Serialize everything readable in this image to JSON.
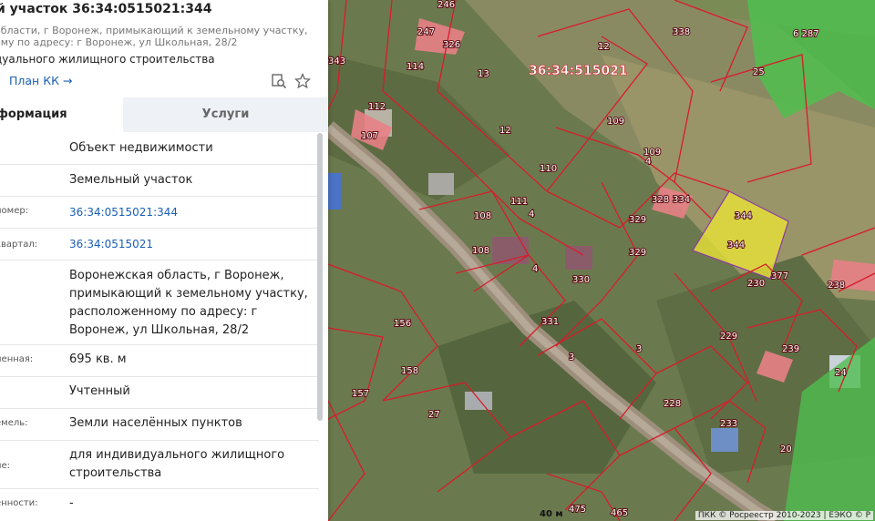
{
  "panel": {
    "title": "й участок 36:34:0515021:344",
    "subaddr": "области, г Воронеж, примыкающий к земельному участку,\nому по адресу: г Воронеж, ул Школьная, 28/2",
    "purpose": "дуального жилищного строительства",
    "plan_link": "План КК →",
    "icons": {
      "search_map": "search-map-icon",
      "favorite": "star-icon"
    },
    "tabs": {
      "info": "формация",
      "services": "Услуги"
    },
    "rows": [
      {
        "label": "",
        "value": "Объект недвижимости"
      },
      {
        "label": "",
        "value": "Земельный участок"
      },
      {
        "label": "номер:",
        "value": "36:34:0515021:344"
      },
      {
        "label": "квартал:",
        "value": "36:34:0515021"
      },
      {
        "label": "",
        "value": "Воронежская область, г Воронеж, примыкающий к земельному участку, расположенному по адресу: г Воронеж, ул Школьная, 28/2"
      },
      {
        "label": "ненная:",
        "value": "695 кв. м"
      },
      {
        "label": "",
        "value": "Учтенный"
      },
      {
        "label": "емель:",
        "value": "Земли населённых пунктов"
      },
      {
        "label": "ие:",
        "value": "для индивидуального жилищного строительства"
      },
      {
        "label": "енности:",
        "value": "-"
      }
    ]
  },
  "map": {
    "quarter_label": "36:34:515021",
    "labels": [
      "246",
      "247",
      "326",
      "338",
      "6 287",
      "25",
      "114",
      "13",
      "12",
      "343",
      "112",
      "107",
      "109",
      "12",
      "109",
      "4",
      "110",
      "328",
      "334",
      "344",
      "344",
      "111",
      "108",
      "4",
      "329",
      "108",
      "329",
      "330",
      "4",
      "230",
      "377",
      "238",
      "156",
      "331",
      "3",
      "229",
      "239",
      "158",
      "3",
      "24",
      "157",
      "228",
      "27",
      "233",
      "20",
      "475",
      "465"
    ],
    "scale": "40 м",
    "attribution": "ПКК © Росреестр 2010-2023 | ЕЭКО © Р"
  }
}
